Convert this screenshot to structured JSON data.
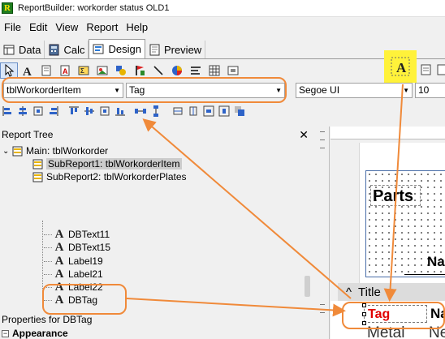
{
  "window": {
    "title": "ReportBuilder: workorder status OLD1",
    "app_icon_letter": "R"
  },
  "menu": {
    "items": [
      "File",
      "Edit",
      "View",
      "Report",
      "Help"
    ]
  },
  "tabs": [
    {
      "label": "Data",
      "active": false
    },
    {
      "label": "Calc",
      "active": false
    },
    {
      "label": "Design",
      "active": true
    },
    {
      "label": "Preview",
      "active": false
    }
  ],
  "toolbar": {
    "dataset_combo": "tblWorkorderItem",
    "field_combo": "Tag",
    "font_combo": "Segoe UI",
    "size_combo": "10"
  },
  "report_tree": {
    "title": "Report Tree",
    "close_glyph": "✕",
    "expand_glyph": "⌄",
    "main": "Main: tblWorkorder",
    "subreports": [
      "SubReport1: tblWorkorderItem",
      "SubReport2: tblWorkorderPlates"
    ],
    "components": [
      "DBText11",
      "DBText15",
      "Label19",
      "Label21",
      "Label22",
      "DBTag"
    ]
  },
  "properties": {
    "header": "Properties for DBTag",
    "group": "Appearance",
    "group_toggle": "−"
  },
  "designer": {
    "header_label": "Parts",
    "na_label": "Na",
    "band_title": "Title",
    "band_chevron": "^",
    "tag_label": "Tag",
    "metal_text": "Metal",
    "ne_text": "Ne"
  },
  "colors": {
    "highlight_orange": "#f08a3a",
    "highlight_yellow": "#fff23a",
    "tag_red": "#e00000",
    "selection_gray": "#cccccc"
  }
}
